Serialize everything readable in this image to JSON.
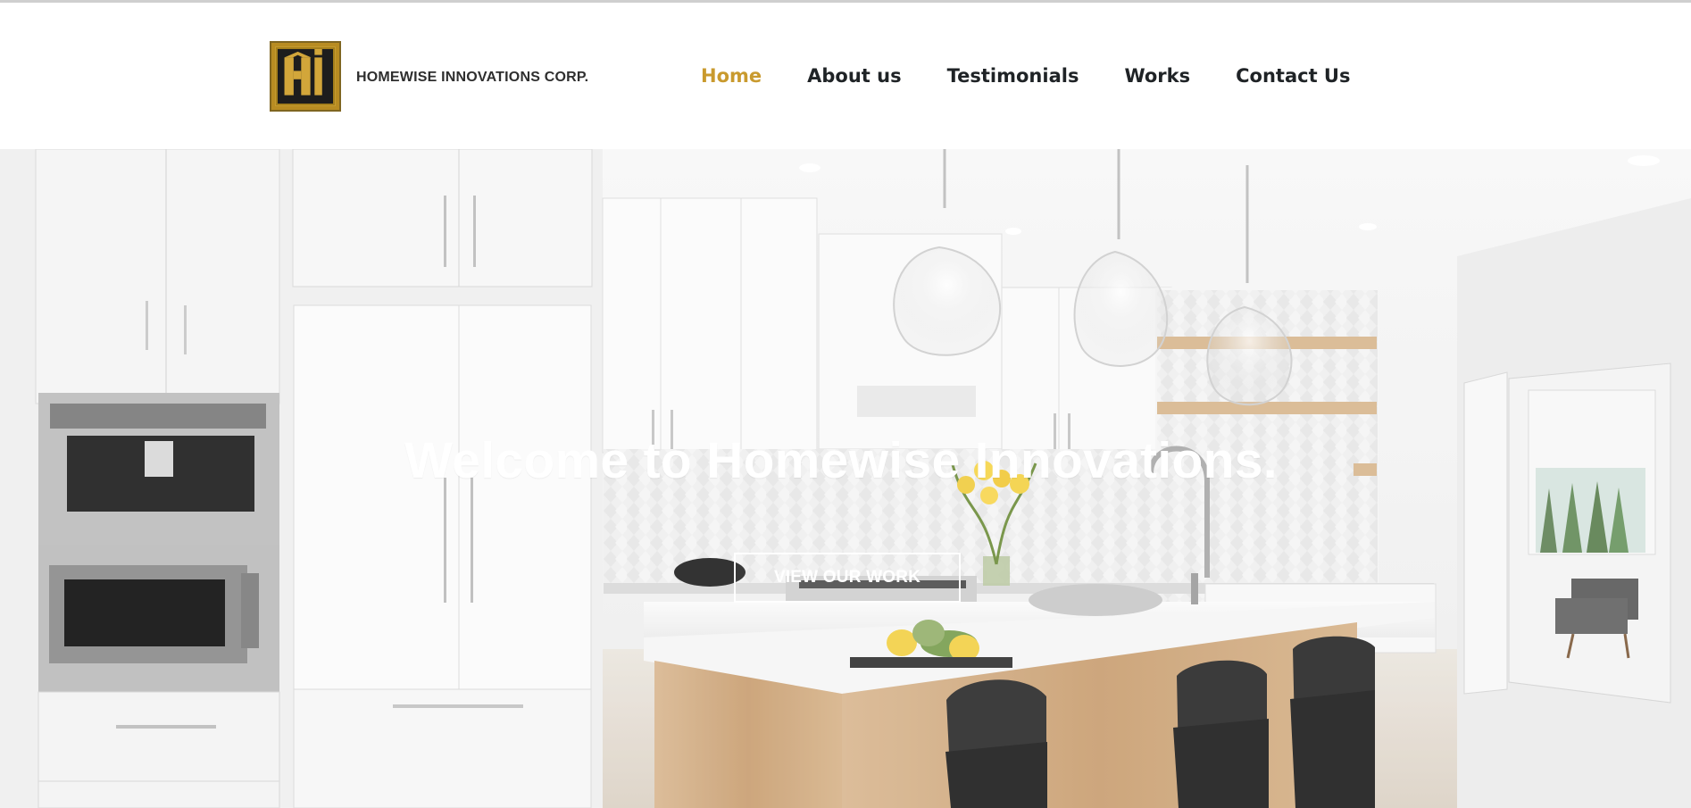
{
  "brand": {
    "name": "HOMEWISE INNOVATIONS CORP.",
    "logo_text": "Hi",
    "logo_colors": {
      "gold": "#c59b2f",
      "dark": "#1d1d1d"
    }
  },
  "nav": {
    "items": [
      {
        "label": "Home",
        "active": true
      },
      {
        "label": "About us",
        "active": false
      },
      {
        "label": "Testimonials",
        "active": false
      },
      {
        "label": "Works",
        "active": false
      },
      {
        "label": "Contact Us",
        "active": false
      }
    ],
    "active_color": "#c99a2e",
    "text_color": "#1f2326"
  },
  "hero": {
    "title": "Welcome to Homewise Innovations.",
    "button_label": "VIEW OUR WORK"
  }
}
